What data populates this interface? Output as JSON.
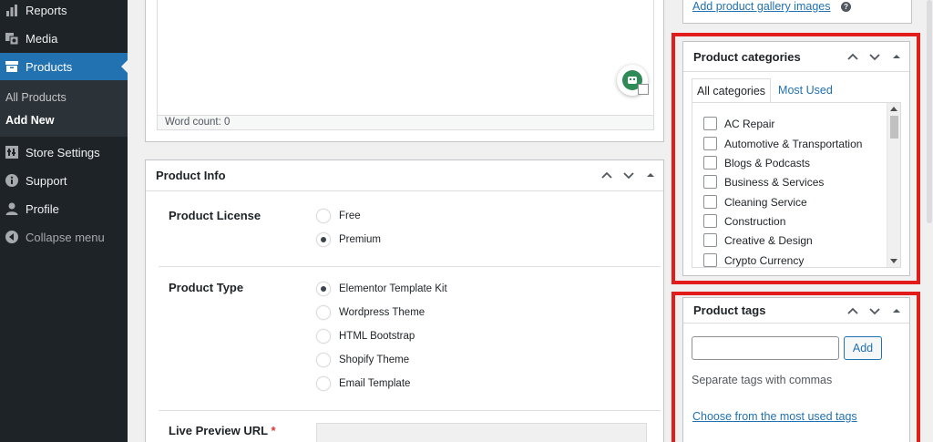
{
  "sidebar": {
    "items": [
      {
        "label": "Reports",
        "icon": "bar-chart-icon"
      },
      {
        "label": "Media",
        "icon": "media-icon"
      },
      {
        "label": "Products",
        "icon": "archive-icon"
      },
      {
        "label": "Store Settings",
        "icon": "store-settings-icon"
      },
      {
        "label": "Support",
        "icon": "info-icon"
      },
      {
        "label": "Profile",
        "icon": "user-icon"
      },
      {
        "label": "Collapse menu",
        "icon": "collapse-arrow-icon"
      }
    ],
    "submenu": [
      "All Products",
      "Add New"
    ]
  },
  "editor": {
    "word_count": "Word count: 0"
  },
  "product_info": {
    "title": "Product Info",
    "license": {
      "label": "Product License",
      "options": [
        {
          "label": "Free",
          "checked": false
        },
        {
          "label": "Premium",
          "checked": true
        }
      ]
    },
    "type": {
      "label": "Product Type",
      "options": [
        {
          "label": "Elementor Template Kit",
          "checked": true
        },
        {
          "label": "Wordpress Theme",
          "checked": false
        },
        {
          "label": "HTML Bootstrap",
          "checked": false
        },
        {
          "label": "Shopify Theme",
          "checked": false
        },
        {
          "label": "Email Template",
          "checked": false
        }
      ]
    },
    "live_preview": {
      "label": "Live Preview URL",
      "required_mark": "*"
    }
  },
  "gallery": {
    "link": "Add product gallery images",
    "help": "?"
  },
  "categories": {
    "title": "Product categories",
    "tabs": [
      "All categories",
      "Most Used"
    ],
    "items": [
      "AC Repair",
      "Automotive & Transportation",
      "Blogs & Podcasts",
      "Business & Services",
      "Cleaning Service",
      "Construction",
      "Creative & Design",
      "Crypto Currency"
    ]
  },
  "tags": {
    "title": "Product tags",
    "input_value": "",
    "add_label": "Add",
    "hint": "Separate tags with commas",
    "choose_link": "Choose from the most used tags"
  },
  "colors": {
    "sidebar_bg": "#1d2327",
    "accent": "#2271b1",
    "highlight_frame": "#e21b1b"
  }
}
